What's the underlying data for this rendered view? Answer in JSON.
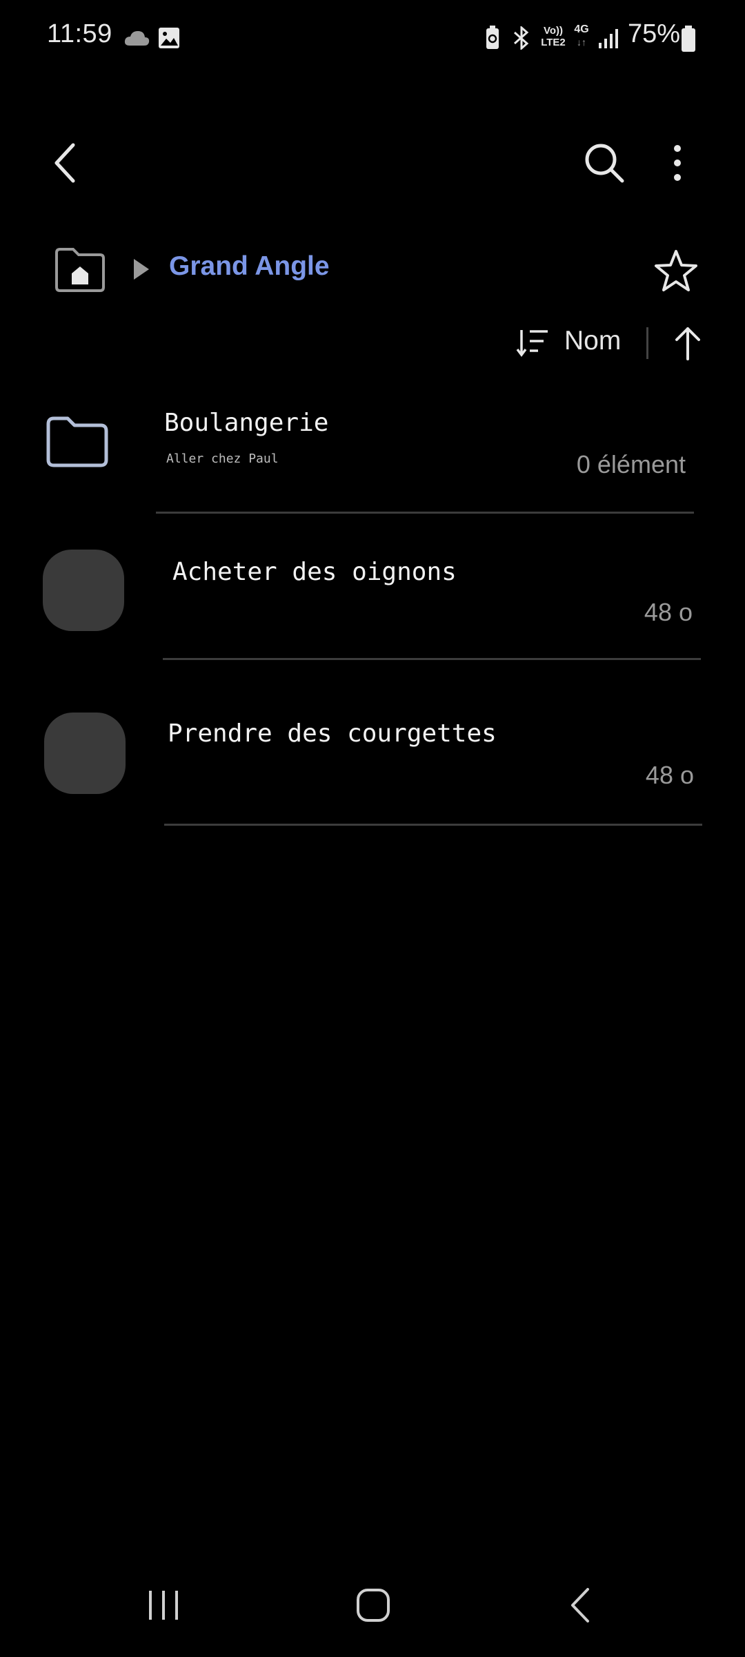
{
  "status_bar": {
    "time": "11:59",
    "battery_percent": "75%",
    "icons": [
      "cloud-icon",
      "image-icon",
      "battery-saver-icon",
      "bluetooth-icon",
      "volte-icon",
      "4g-icon",
      "signal-icon",
      "battery-icon"
    ],
    "volte_label_top": "Vo))",
    "volte_label_bottom": "LTE2",
    "network_label": "4G"
  },
  "toolbar": {
    "icons": [
      "back-arrow-icon",
      "search-icon",
      "more-vert-icon"
    ]
  },
  "breadcrumb": {
    "current_folder": "Grand Angle",
    "icons": [
      "home-folder-icon",
      "chevron-right-icon",
      "star-icon"
    ]
  },
  "sort": {
    "label": "Nom",
    "icons": [
      "sort-icon",
      "arrow-up-icon"
    ]
  },
  "items": [
    {
      "type": "folder",
      "title": "Boulangerie",
      "subtitle": "Aller chez Paul",
      "meta": "0 élément"
    },
    {
      "type": "file",
      "title": "Acheter des oignons",
      "meta": "48 o"
    },
    {
      "type": "file",
      "title": "Prendre des courgettes",
      "meta": "48 o"
    }
  ],
  "nav_bar": {
    "icons": [
      "recents-icon",
      "home-icon",
      "back-icon"
    ]
  },
  "colors": {
    "background": "#000000",
    "accent": "#7b96e6",
    "thumbnail": "#3a3a3a"
  }
}
